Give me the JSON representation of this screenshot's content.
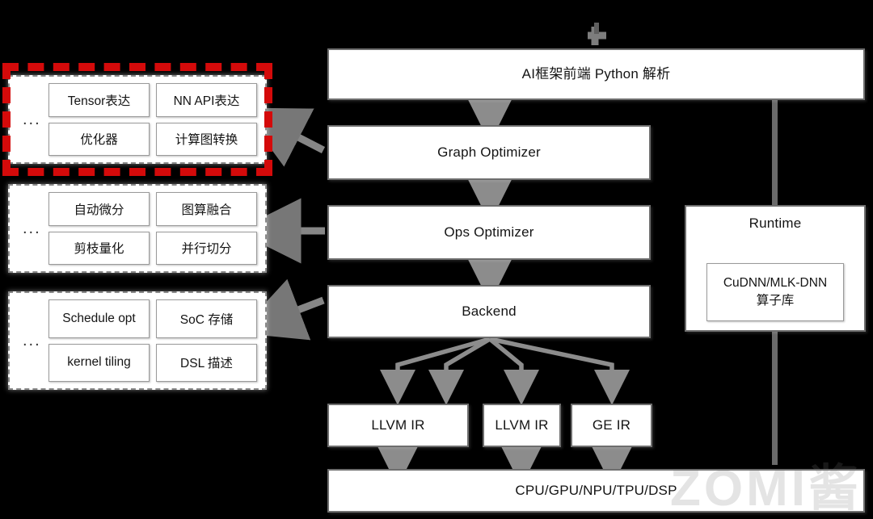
{
  "diagram": {
    "title": "AI compiler stack architecture",
    "watermark": "ZOMI酱",
    "colors": {
      "background": "#000000",
      "node_fill": "#ffffff",
      "node_border": "#6e6e6e",
      "group_border": "#8a8a8a",
      "highlight_red": "#d40a0a",
      "connector_gray": "#6a6a6a"
    }
  },
  "left_groups": [
    {
      "id": "frontend-group",
      "ellipsis": "...",
      "highlighted": true,
      "cards": [
        {
          "label": "Tensor表达"
        },
        {
          "label": "NN API表达"
        },
        {
          "label": "优化器"
        },
        {
          "label": "计算图转换"
        }
      ]
    },
    {
      "id": "graph-group",
      "ellipsis": "...",
      "highlighted": false,
      "cards": [
        {
          "label": "自动微分"
        },
        {
          "label": "图算融合"
        },
        {
          "label": "剪枝量化"
        },
        {
          "label": "并行切分"
        }
      ]
    },
    {
      "id": "ops-group",
      "ellipsis": "...",
      "highlighted": false,
      "cards": [
        {
          "label": "Schedule opt"
        },
        {
          "label": "SoC 存储"
        },
        {
          "label": "kernel tiling"
        },
        {
          "label": "DSL 描述"
        }
      ]
    }
  ],
  "pipeline": [
    {
      "id": "frontend",
      "label": "AI框架前端 Python 解析"
    },
    {
      "id": "graph-optimizer",
      "label": "Graph Optimizer"
    },
    {
      "id": "ops-optimizer",
      "label": "Ops Optimizer"
    },
    {
      "id": "backend",
      "label": "Backend"
    }
  ],
  "ir_nodes": [
    {
      "id": "llvm-ir-1",
      "label": "LLVM IR"
    },
    {
      "id": "llvm-ir-2",
      "label": "LLVM IR"
    },
    {
      "id": "ge-ir",
      "label": "GE IR"
    }
  ],
  "runtime": {
    "title": "Runtime",
    "library": "CuDNN/MLK-DNN\n算子库",
    "library_line1": "CuDNN/MLK-DNN",
    "library_line2": "算子库"
  },
  "hardware": {
    "label": "CPU/GPU/NPU/TPU/DSP"
  }
}
